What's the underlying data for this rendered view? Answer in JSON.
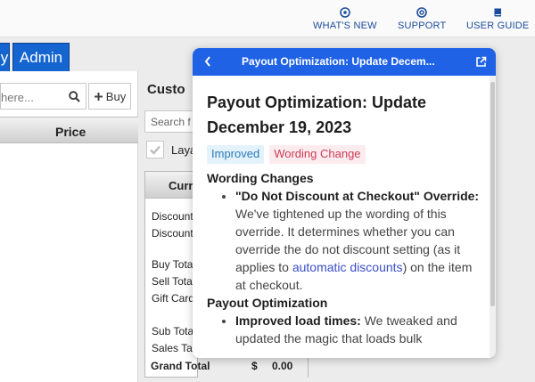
{
  "topbar": {
    "whats_new": "WHAT'S NEW",
    "support": "SUPPORT",
    "user_guide": "USER GUIDE"
  },
  "nav": {
    "partial_button": "y",
    "admin_button": "Admin"
  },
  "search": {
    "placeholder_fragment": "here...",
    "buy_label": "Buy"
  },
  "table": {
    "price_header": "Price"
  },
  "customer": {
    "title": "Custo",
    "search_fragment": "Search f",
    "checkbox_fragment": "Laya"
  },
  "totals": {
    "header_fragment": "Curr",
    "rows": [
      "Discount",
      "Discount",
      "Buy Tota",
      "Sell Tota",
      "Gift Card",
      "Sub Tota",
      "Sales Ta"
    ],
    "grand_label": "Grand Total",
    "grand_currency": "$",
    "grand_value": "0.00"
  },
  "popup": {
    "header_title": "Payout Optimization: Update Decem...",
    "article_title": "Payout Optimization: Update December 19, 2023",
    "tags": [
      "Improved",
      "Wording Change"
    ],
    "section1_title": "Wording Changes",
    "item1_bold": "\"Do Not Discount at Checkout\" Override:",
    "item1_text_a": " We've tightened up the wording of this override. It determines whether you can override the do not discount setting (as it applies to ",
    "item1_link": "automatic discounts",
    "item1_text_b": ") on the item at checkout.",
    "section2_title": "Payout Optimization",
    "item2_bold": "Improved load times:",
    "item2_text": " We tweaked and updated the magic that loads bulk"
  },
  "colors": {
    "accent": "#1f62e6",
    "nav_button": "#1565d0",
    "link": "#3a4ec9",
    "topbar_link": "#1b4b9b"
  }
}
